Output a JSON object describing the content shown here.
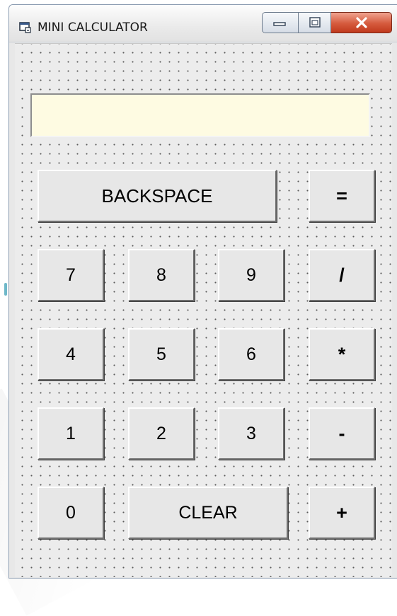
{
  "window": {
    "title": "MINI CALCULATOR",
    "app_icon": "calculator-form-icon",
    "caption_buttons": {
      "minimize_icon": "minimize-icon",
      "maximize_icon": "maximize-icon",
      "close_icon": "close-icon"
    }
  },
  "display": {
    "value": ""
  },
  "buttons": {
    "backspace": "BACKSPACE",
    "equals": "=",
    "seven": "7",
    "eight": "8",
    "nine": "9",
    "divide": "/",
    "four": "4",
    "five": "5",
    "six": "6",
    "multiply": "*",
    "one": "1",
    "two": "2",
    "three": "3",
    "subtract": "-",
    "zero": "0",
    "clear": "CLEAR",
    "add": "+"
  },
  "colors": {
    "display_background": "#fefbe2",
    "button_face": "#e7e7e7",
    "close_button": "#d55a3d",
    "form_background": "#ececec"
  }
}
